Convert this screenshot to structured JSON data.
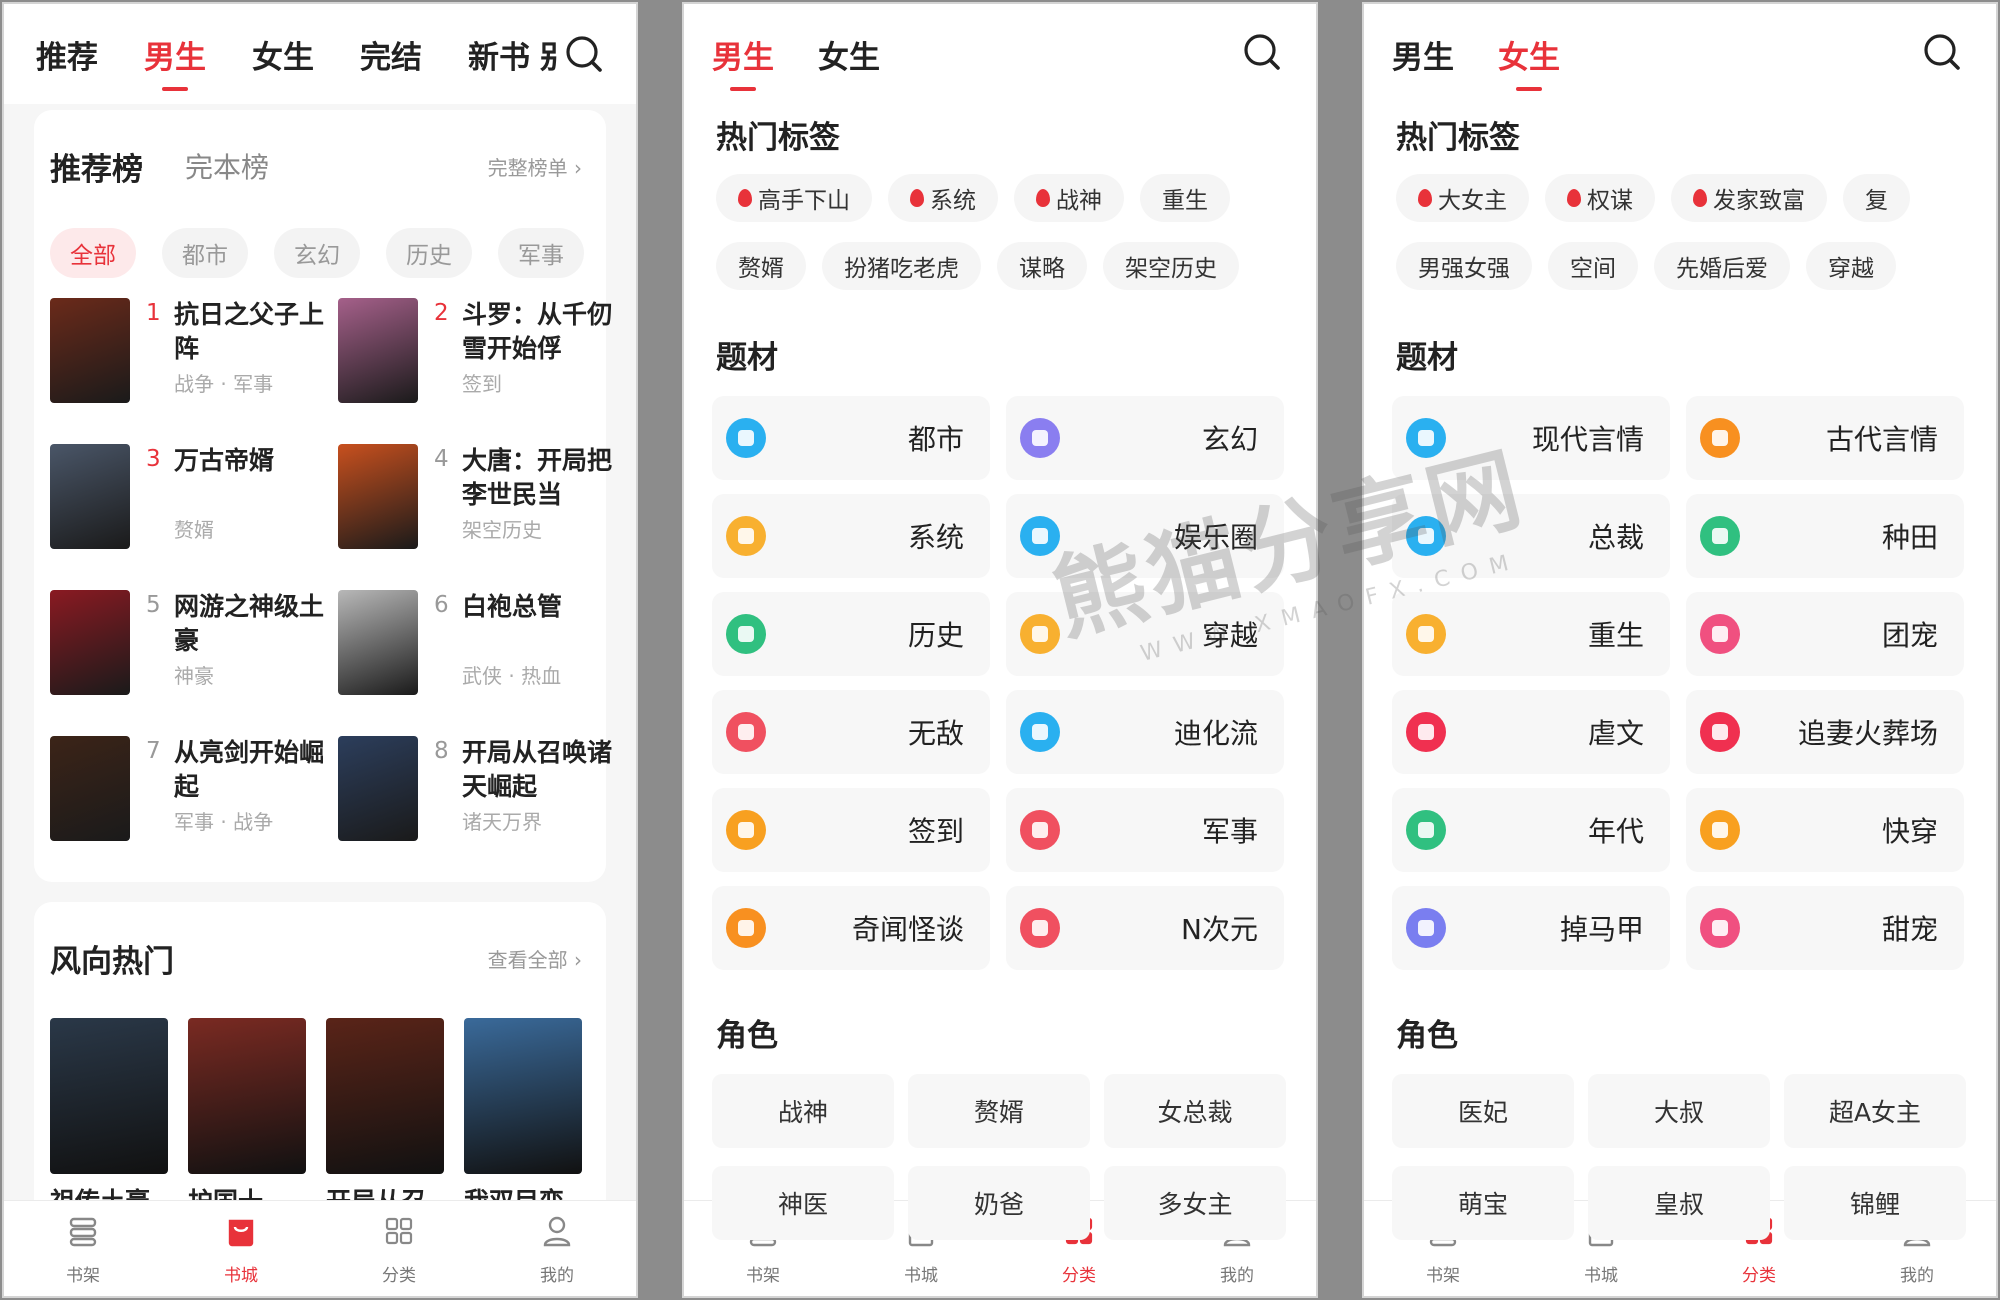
{
  "accent": "#e8323a",
  "screen1": {
    "tabs": [
      "推荐",
      "男生",
      "女生",
      "完结",
      "新书",
      "别"
    ],
    "active_tab": 1,
    "rank_card": {
      "title": "推荐榜",
      "alt_title": "完本榜",
      "more": "完整榜单 ›",
      "chips": [
        "全部",
        "都市",
        "玄幻",
        "历史",
        "军事"
      ],
      "books": [
        {
          "num": "1",
          "title": "抗日之父子上阵",
          "tags": "战争 · 军事",
          "color": "#6b2a1a"
        },
        {
          "num": "2",
          "title": "斗罗：从千仞雪开始俘",
          "tags": "签到",
          "color": "#a5608a"
        },
        {
          "num": "3",
          "title": "万古帝婿",
          "tags": "赘婿",
          "color": "#4a5668"
        },
        {
          "num": "4",
          "title": "大唐：开局把李世民当",
          "tags": "架空历史",
          "color": "#c8501e"
        },
        {
          "num": "5",
          "title": "网游之神级土豪",
          "tags": "神豪",
          "color": "#8a1a22"
        },
        {
          "num": "6",
          "title": "白袍总管",
          "tags": "武侠 · 热血",
          "color": "#b8b8b8"
        },
        {
          "num": "7",
          "title": "从亮剑开始崛起",
          "tags": "军事 · 战争",
          "color": "#3c2418"
        },
        {
          "num": "8",
          "title": "开局从召唤诸天崛起",
          "tags": "诸天万界",
          "color": "#2c3e5c"
        }
      ]
    },
    "hot_card": {
      "title": "风向热门",
      "more": "查看全部 ›",
      "books": [
        {
          "title": "祖传土豪",
          "color": "#2a3848"
        },
        {
          "title": "护国十",
          "color": "#7a2a22"
        },
        {
          "title": "开局从召",
          "color": "#5a2418"
        },
        {
          "title": "我双目变",
          "color": "#3a6a9a"
        }
      ]
    },
    "nav": [
      "书架",
      "书城",
      "分类",
      "我的"
    ],
    "nav_active": 1
  },
  "screen2": {
    "tabs": [
      "男生",
      "女生"
    ],
    "active_tab": 0,
    "hot_tags_title": "热门标签",
    "hot_tags_row1": [
      {
        "label": "高手下山",
        "hot": true
      },
      {
        "label": "系统",
        "hot": true
      },
      {
        "label": "战神",
        "hot": true
      },
      {
        "label": "重生",
        "hot": false
      }
    ],
    "hot_tags_row2": [
      "赘婿",
      "扮猪吃老虎",
      "谋略",
      "架空历史"
    ],
    "genre_title": "题材",
    "genres": [
      {
        "label": "都市",
        "color": "#2ab0f0"
      },
      {
        "label": "玄幻",
        "color": "#8a7ef0"
      },
      {
        "label": "系统",
        "color": "#f8b030"
      },
      {
        "label": "娱乐圈",
        "color": "#2ab0f0"
      },
      {
        "label": "历史",
        "color": "#30c080"
      },
      {
        "label": "穿越",
        "color": "#f8b030"
      },
      {
        "label": "无敌",
        "color": "#f05060"
      },
      {
        "label": "迪化流",
        "color": "#2ab0f0"
      },
      {
        "label": "签到",
        "color": "#f8a020"
      },
      {
        "label": "军事",
        "color": "#f05060"
      },
      {
        "label": "奇闻怪谈",
        "color": "#f89020"
      },
      {
        "label": "N次元",
        "color": "#f05060"
      }
    ],
    "role_title": "角色",
    "roles": [
      "战神",
      "赘婿",
      "女总裁",
      "神医",
      "奶爸",
      "多女主"
    ],
    "nav": [
      "书架",
      "书城",
      "分类",
      "我的"
    ],
    "nav_active": 2
  },
  "screen3": {
    "tabs": [
      "男生",
      "女生"
    ],
    "active_tab": 1,
    "hot_tags_title": "热门标签",
    "hot_tags_row1": [
      {
        "label": "大女主",
        "hot": true
      },
      {
        "label": "权谋",
        "hot": true
      },
      {
        "label": "发家致富",
        "hot": true
      },
      {
        "label": "复",
        "hot": false
      }
    ],
    "hot_tags_row2": [
      "男强女强",
      "空间",
      "先婚后爱",
      "穿越"
    ],
    "genre_title": "题材",
    "genres": [
      {
        "label": "现代言情",
        "color": "#2ab0f0"
      },
      {
        "label": "古代言情",
        "color": "#f89020"
      },
      {
        "label": "总裁",
        "color": "#2ab0f0"
      },
      {
        "label": "种田",
        "color": "#30c080"
      },
      {
        "label": "重生",
        "color": "#f8b030"
      },
      {
        "label": "团宠",
        "color": "#f05080"
      },
      {
        "label": "虐文",
        "color": "#f03050"
      },
      {
        "label": "追妻火葬场",
        "color": "#f03050"
      },
      {
        "label": "年代",
        "color": "#30c080"
      },
      {
        "label": "快穿",
        "color": "#f8a020"
      },
      {
        "label": "掉马甲",
        "color": "#7a7ef0"
      },
      {
        "label": "甜宠",
        "color": "#f05080"
      }
    ],
    "role_title": "角色",
    "roles": [
      "医妃",
      "大叔",
      "超A女主",
      "萌宝",
      "皇叔",
      "锦鲤"
    ],
    "nav": [
      "书架",
      "书城",
      "分类",
      "我的"
    ],
    "nav_active": 2
  },
  "watermark": {
    "text": "熊猫分享网",
    "sub": "WWW.XMAOFX.COM"
  }
}
